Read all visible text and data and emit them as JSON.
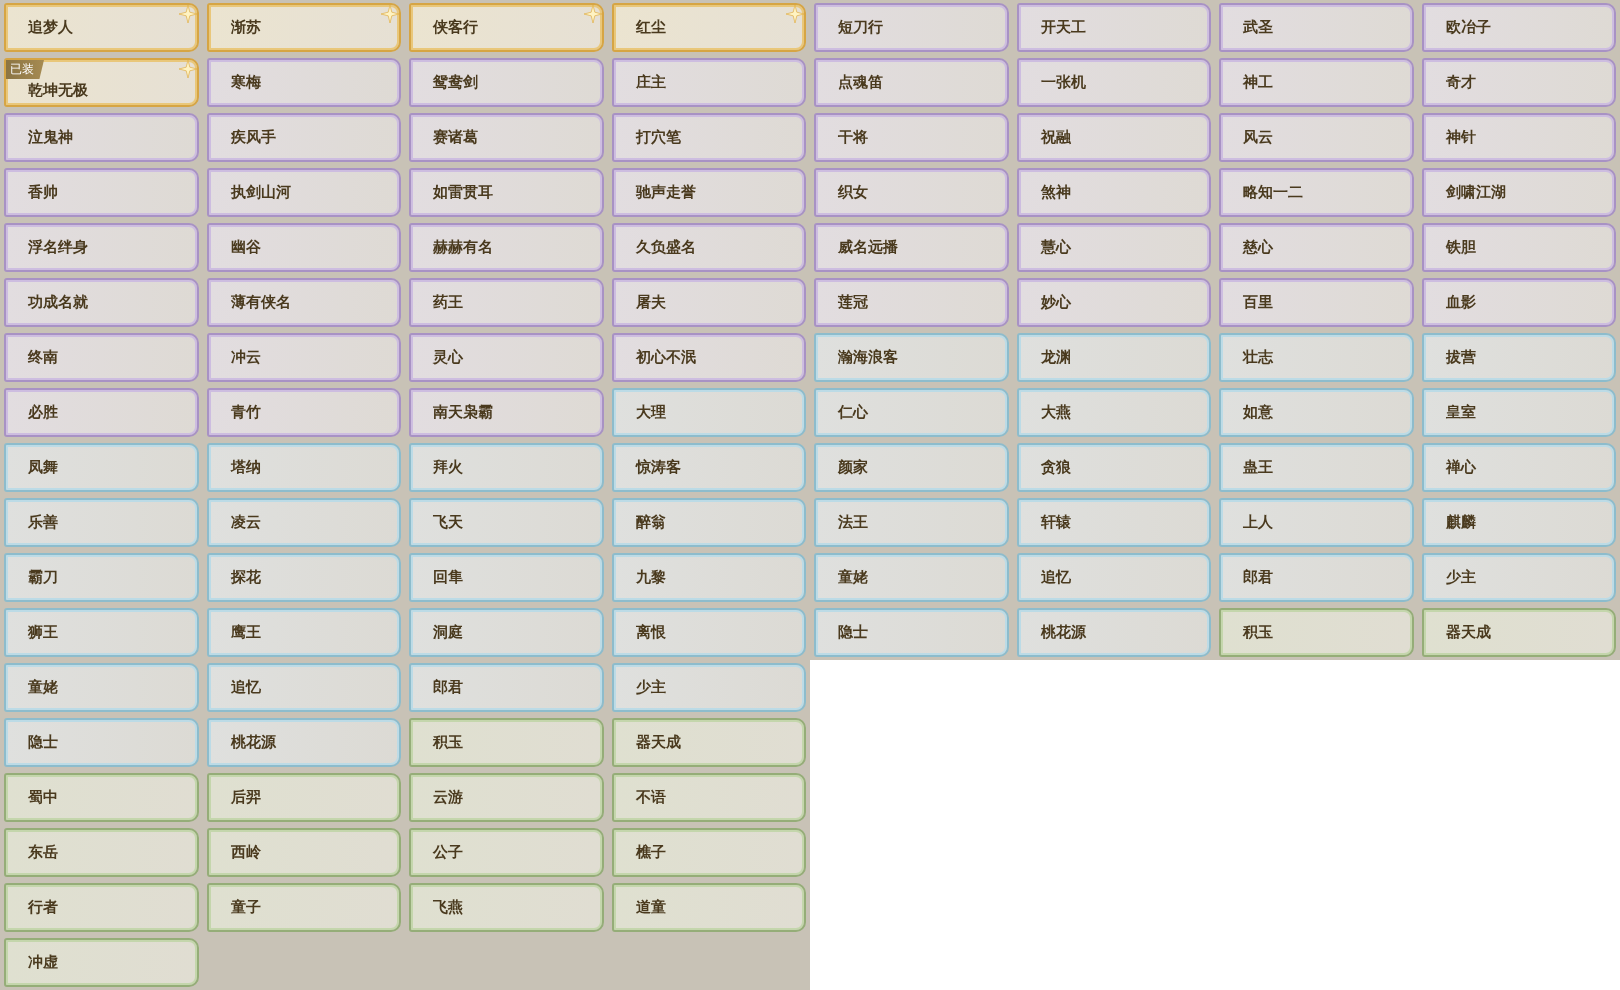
{
  "left_panel": {
    "cards": [
      {
        "label": "追梦人",
        "kind": "gold"
      },
      {
        "label": "渐苏",
        "kind": "gold"
      },
      {
        "label": "侠客行",
        "kind": "gold"
      },
      {
        "label": "红尘",
        "kind": "gold"
      },
      {
        "label": "乾坤无极",
        "kind": "gold",
        "badge": "已装"
      },
      {
        "label": "寒梅",
        "kind": "purple"
      },
      {
        "label": "鸳鸯剑",
        "kind": "purple"
      },
      {
        "label": "庄主",
        "kind": "purple"
      },
      {
        "label": "泣鬼神",
        "kind": "purple"
      },
      {
        "label": "疾风手",
        "kind": "purple"
      },
      {
        "label": "赛诸葛",
        "kind": "purple"
      },
      {
        "label": "打穴笔",
        "kind": "purple"
      },
      {
        "label": "香帅",
        "kind": "purple"
      },
      {
        "label": "执剑山河",
        "kind": "purple"
      },
      {
        "label": "如雷贯耳",
        "kind": "purple"
      },
      {
        "label": "驰声走誉",
        "kind": "purple"
      },
      {
        "label": "浮名绊身",
        "kind": "purple"
      },
      {
        "label": "幽谷",
        "kind": "purple"
      },
      {
        "label": "赫赫有名",
        "kind": "purple"
      },
      {
        "label": "久负盛名",
        "kind": "purple"
      },
      {
        "label": "功成名就",
        "kind": "purple"
      },
      {
        "label": "薄有侠名",
        "kind": "purple"
      },
      {
        "label": "药王",
        "kind": "purple"
      },
      {
        "label": "屠夫",
        "kind": "purple"
      },
      {
        "label": "终南",
        "kind": "purple"
      },
      {
        "label": "冲云",
        "kind": "purple"
      },
      {
        "label": "灵心",
        "kind": "purple"
      },
      {
        "label": "初心不泯",
        "kind": "purple"
      },
      {
        "label": "必胜",
        "kind": "purple"
      },
      {
        "label": "青竹",
        "kind": "purple"
      },
      {
        "label": "南天枭霸",
        "kind": "purple"
      },
      {
        "label": "大理",
        "kind": "blue"
      },
      {
        "label": "凤舞",
        "kind": "blue"
      },
      {
        "label": "塔纳",
        "kind": "blue"
      },
      {
        "label": "拜火",
        "kind": "blue"
      },
      {
        "label": "惊涛客",
        "kind": "blue"
      },
      {
        "label": "乐善",
        "kind": "blue"
      },
      {
        "label": "凌云",
        "kind": "blue"
      },
      {
        "label": "飞天",
        "kind": "blue"
      },
      {
        "label": "醉翁",
        "kind": "blue"
      },
      {
        "label": "霸刀",
        "kind": "blue"
      },
      {
        "label": "探花",
        "kind": "blue"
      },
      {
        "label": "回隼",
        "kind": "blue"
      },
      {
        "label": "九黎",
        "kind": "blue"
      },
      {
        "label": "狮王",
        "kind": "blue"
      },
      {
        "label": "鹰王",
        "kind": "blue"
      },
      {
        "label": "洞庭",
        "kind": "blue"
      },
      {
        "label": "离恨",
        "kind": "blue"
      },
      {
        "label": "童姥",
        "kind": "blue"
      },
      {
        "label": "追忆",
        "kind": "blue"
      },
      {
        "label": "郎君",
        "kind": "blue"
      },
      {
        "label": "少主",
        "kind": "blue"
      },
      {
        "label": "隐士",
        "kind": "blue"
      },
      {
        "label": "桃花源",
        "kind": "blue"
      },
      {
        "label": "积玉",
        "kind": "green"
      },
      {
        "label": "器天成",
        "kind": "green"
      },
      {
        "label": "蜀中",
        "kind": "green"
      },
      {
        "label": "后羿",
        "kind": "green"
      },
      {
        "label": "云游",
        "kind": "green"
      },
      {
        "label": "不语",
        "kind": "green"
      },
      {
        "label": "东岳",
        "kind": "green"
      },
      {
        "label": "西岭",
        "kind": "green"
      },
      {
        "label": "公子",
        "kind": "green"
      },
      {
        "label": "樵子",
        "kind": "green"
      },
      {
        "label": "行者",
        "kind": "green"
      },
      {
        "label": "童子",
        "kind": "green"
      },
      {
        "label": "飞燕",
        "kind": "green"
      },
      {
        "label": "道童",
        "kind": "green"
      },
      {
        "label": "冲虚",
        "kind": "green"
      }
    ]
  },
  "right_panel": {
    "cards": [
      {
        "label": "短刀行",
        "kind": "purple"
      },
      {
        "label": "开天工",
        "kind": "purple"
      },
      {
        "label": "武圣",
        "kind": "purple"
      },
      {
        "label": "欧冶子",
        "kind": "purple"
      },
      {
        "label": "点魂笛",
        "kind": "purple"
      },
      {
        "label": "一张机",
        "kind": "purple"
      },
      {
        "label": "神工",
        "kind": "purple"
      },
      {
        "label": "奇才",
        "kind": "purple"
      },
      {
        "label": "干将",
        "kind": "purple"
      },
      {
        "label": "祝融",
        "kind": "purple"
      },
      {
        "label": "风云",
        "kind": "purple"
      },
      {
        "label": "神针",
        "kind": "purple"
      },
      {
        "label": "织女",
        "kind": "purple"
      },
      {
        "label": "煞神",
        "kind": "purple"
      },
      {
        "label": "略知一二",
        "kind": "purple"
      },
      {
        "label": "剑啸江湖",
        "kind": "purple"
      },
      {
        "label": "威名远播",
        "kind": "purple"
      },
      {
        "label": "慧心",
        "kind": "purple"
      },
      {
        "label": "慈心",
        "kind": "purple"
      },
      {
        "label": "铁胆",
        "kind": "purple"
      },
      {
        "label": "莲冠",
        "kind": "purple"
      },
      {
        "label": "妙心",
        "kind": "purple"
      },
      {
        "label": "百里",
        "kind": "purple"
      },
      {
        "label": "血影",
        "kind": "purple"
      },
      {
        "label": "瀚海浪客",
        "kind": "blue"
      },
      {
        "label": "龙渊",
        "kind": "blue"
      },
      {
        "label": "壮志",
        "kind": "blue"
      },
      {
        "label": "拔营",
        "kind": "blue"
      },
      {
        "label": "仁心",
        "kind": "blue"
      },
      {
        "label": "大燕",
        "kind": "blue"
      },
      {
        "label": "如意",
        "kind": "blue"
      },
      {
        "label": "皇室",
        "kind": "blue"
      },
      {
        "label": "颜家",
        "kind": "blue"
      },
      {
        "label": "贪狼",
        "kind": "blue"
      },
      {
        "label": "蛊王",
        "kind": "blue"
      },
      {
        "label": "禅心",
        "kind": "blue"
      },
      {
        "label": "法王",
        "kind": "blue"
      },
      {
        "label": "轩辕",
        "kind": "blue"
      },
      {
        "label": "上人",
        "kind": "blue"
      },
      {
        "label": "麒麟",
        "kind": "blue"
      },
      {
        "label": "童姥",
        "kind": "blue"
      },
      {
        "label": "追忆",
        "kind": "blue"
      },
      {
        "label": "郎君",
        "kind": "blue"
      },
      {
        "label": "少主",
        "kind": "blue"
      },
      {
        "label": "隐士",
        "kind": "blue"
      },
      {
        "label": "桃花源",
        "kind": "blue"
      },
      {
        "label": "积玉",
        "kind": "green"
      },
      {
        "label": "器天成",
        "kind": "green"
      }
    ]
  }
}
